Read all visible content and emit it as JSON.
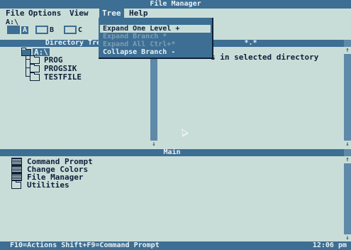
{
  "window": {
    "title": "File Manager"
  },
  "menubar": {
    "items": [
      {
        "label": "File"
      },
      {
        "label": "Options"
      },
      {
        "label": "View"
      },
      {
        "label": "Tree"
      },
      {
        "label": "Help"
      }
    ]
  },
  "tree_menu": {
    "items": [
      {
        "label": "Expand One Level  +",
        "state": "highlighted"
      },
      {
        "label": "Expand Branch    *",
        "state": "disabled"
      },
      {
        "label": "Expand All      Ctrl+*",
        "state": "disabled"
      },
      {
        "label": "Collapse Branch  -",
        "state": "enabled"
      }
    ]
  },
  "drives": {
    "path": "A:\\",
    "list": [
      {
        "label": "A",
        "selected": true
      },
      {
        "label": "B",
        "selected": false
      },
      {
        "label": "C",
        "selected": false
      }
    ]
  },
  "directory_tree": {
    "header": "Directory Tree",
    "root": "A:\\",
    "items": [
      "PROG",
      "PROGSIK",
      "TESTFILE"
    ]
  },
  "file_list": {
    "header": "*.*",
    "message": "s in selected directory"
  },
  "main_group": {
    "header": "Main",
    "items": [
      "Command Prompt",
      "Change Colors",
      "File Manager",
      "Utilities"
    ]
  },
  "status": {
    "left": "F10=Actions   Shift+F9=Command Prompt",
    "time": "12:06 pm"
  },
  "colors": {
    "bar": "#3d6e93",
    "background": "#c9ddd8",
    "text": "#10203a"
  }
}
